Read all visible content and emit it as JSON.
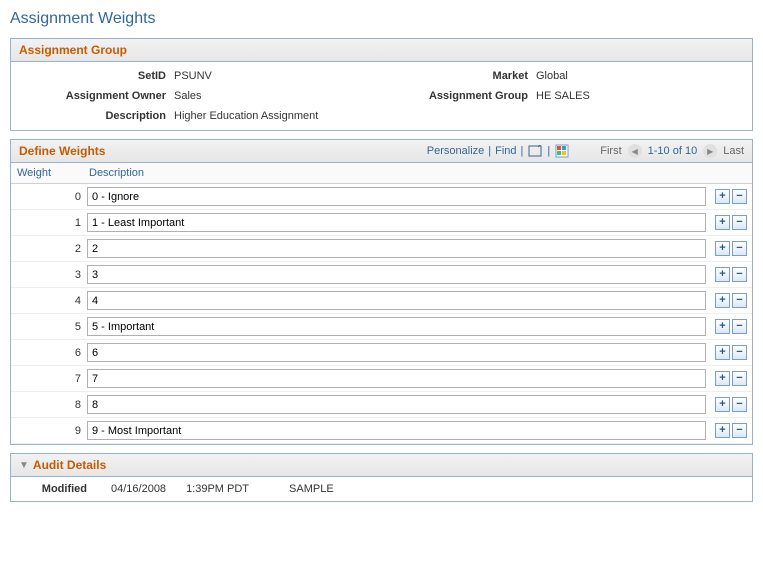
{
  "page": {
    "title": "Assignment Weights"
  },
  "assignmentGroup": {
    "header": "Assignment Group",
    "labels": {
      "setid": "SetID",
      "market": "Market",
      "owner": "Assignment Owner",
      "group": "Assignment Group",
      "description": "Description"
    },
    "values": {
      "setid": "PSUNV",
      "market": "Global",
      "owner": "Sales",
      "group": "HE SALES",
      "description": "Higher Education Assignment"
    }
  },
  "defineWeights": {
    "header": "Define Weights",
    "toolbar": {
      "personalize": "Personalize",
      "find": "Find",
      "first": "First",
      "range": "1-10 of 10",
      "last": "Last"
    },
    "columns": {
      "weight": "Weight",
      "description": "Description"
    },
    "rows": [
      {
        "weight": "0",
        "description": "0 - Ignore"
      },
      {
        "weight": "1",
        "description": "1 - Least Important"
      },
      {
        "weight": "2",
        "description": "2"
      },
      {
        "weight": "3",
        "description": "3"
      },
      {
        "weight": "4",
        "description": "4"
      },
      {
        "weight": "5",
        "description": "5 - Important"
      },
      {
        "weight": "6",
        "description": "6"
      },
      {
        "weight": "7",
        "description": "7"
      },
      {
        "weight": "8",
        "description": "8"
      },
      {
        "weight": "9",
        "description": "9 - Most Important"
      }
    ]
  },
  "auditDetails": {
    "header": "Audit Details",
    "labels": {
      "modified": "Modified"
    },
    "values": {
      "date": "04/16/2008",
      "time": "1:39PM PDT",
      "user": "SAMPLE"
    }
  }
}
